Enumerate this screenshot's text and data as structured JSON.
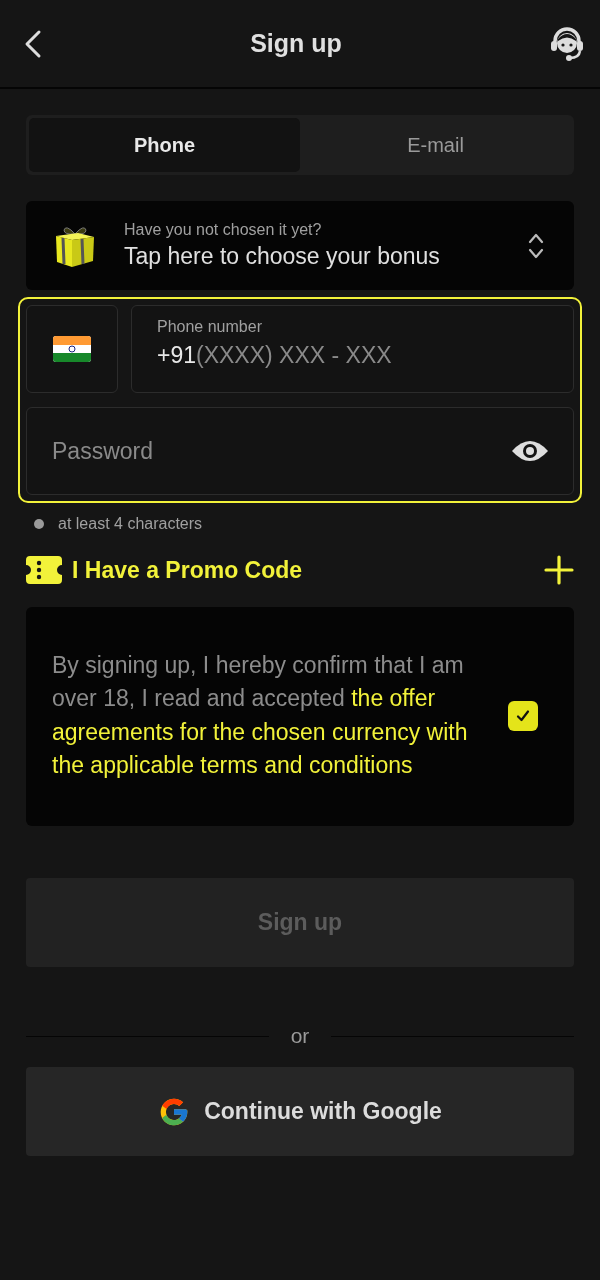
{
  "header": {
    "title": "Sign up"
  },
  "tabs": [
    {
      "label": "Phone",
      "selected": true
    },
    {
      "label": "E-mail",
      "selected": false
    }
  ],
  "bonus": {
    "caption": "Have you not chosen it yet?",
    "label": "Tap here to choose your bonus"
  },
  "phone": {
    "label": "Phone number",
    "prefix": "+91",
    "placeholder": "(XXXX) XXX - XXX"
  },
  "password": {
    "placeholder": "Password"
  },
  "hints": [
    {
      "text": "at least 4 characters"
    }
  ],
  "promo": {
    "label": "I Have a Promo Code"
  },
  "terms": {
    "text": "By signing up, I hereby confirm that I am over 18, I read and accepted **the offer agreements for the chosen currency with the applicable terms and conditions**",
    "checked": true
  },
  "signup_button": {
    "label": "Sign up",
    "disabled": true
  },
  "divider": {
    "label": "or"
  },
  "google_button": {
    "label": "Continue with Google"
  }
}
